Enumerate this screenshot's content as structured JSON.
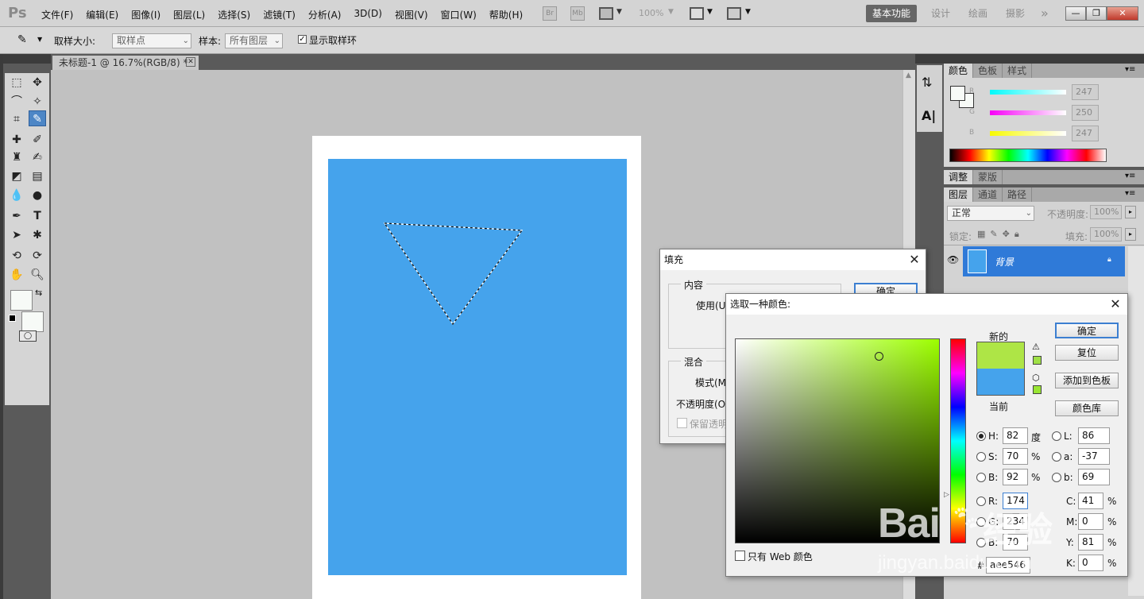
{
  "app": {
    "logo": "Ps"
  },
  "menus": [
    "文件(F)",
    "编辑(E)",
    "图像(I)",
    "图层(L)",
    "选择(S)",
    "滤镜(T)",
    "分析(A)",
    "3D(D)",
    "视图(V)",
    "窗口(W)",
    "帮助(H)"
  ],
  "appbar": {
    "br_label": "Br",
    "mb_label": "Mb",
    "zoom": "100%"
  },
  "workspaces": [
    "基本功能",
    "设计",
    "绘画",
    "摄影"
  ],
  "workspace_more": "»",
  "window_controls": {
    "minimize": "—",
    "restore": "❐",
    "close": "✕"
  },
  "options": {
    "sample_size_label": "取样大小:",
    "sample_size_value": "取样点",
    "sample_label": "样本:",
    "sample_value": "所有图层",
    "show_ring_label": "显示取样环",
    "show_ring_checked": true
  },
  "document": {
    "tab_title": "未标题-1 @ 16.7%(RGB/8) *",
    "close": "✕",
    "fill_color": "#45a3ec"
  },
  "color_panel": {
    "tabs": [
      "颜色",
      "色板",
      "样式"
    ],
    "r_label": "R",
    "r": "247",
    "g_label": "G",
    "g": "250",
    "b_label": "B",
    "b": "247"
  },
  "adjust_panel": {
    "tabs": [
      "调整",
      "蒙版"
    ]
  },
  "layers_panel": {
    "tabs": [
      "图层",
      "通道",
      "路径"
    ],
    "blend_mode": "正常",
    "opacity_label": "不透明度:",
    "opacity": "100%",
    "lock_label": "锁定:",
    "fill_label": "填充:",
    "fill": "100%",
    "layer_name": "背景",
    "layer_color": "#45a3ec"
  },
  "fill_dialog": {
    "title": "填充",
    "contents_group": "内容",
    "use_label": "使用(U",
    "ok": "确定",
    "blending_group": "混合",
    "mode_label": "模式(M",
    "opacity_label": "不透明度(O",
    "preserve_label": "保留透明"
  },
  "picker": {
    "title": "选取一种颜色:",
    "new_label": "新的",
    "current_label": "当前",
    "new_color": "#aee546",
    "current_color": "#45a3ec",
    "hue_color": "#9dff00",
    "ok": "确定",
    "reset": "复位",
    "add_swatch": "添加到色板",
    "color_libraries": "颜色库",
    "web_only_label": "只有 Web 颜色",
    "h_label": "H:",
    "h": "82",
    "h_unit": "度",
    "s_label": "S:",
    "s": "70",
    "s_unit": "%",
    "br_label": "B:",
    "br": "92",
    "br_unit": "%",
    "r_label": "R:",
    "r": "174",
    "g_label": "G:",
    "g": "234",
    "bb_label": "B:",
    "bb": "70",
    "l_label": "L:",
    "l": "86",
    "a_label": "a:",
    "a": "-37",
    "lab_b_label": "b:",
    "lab_b": "69",
    "c_label": "C:",
    "c": "41",
    "m_label": "M:",
    "m": "0",
    "y_label": "Y:",
    "y": "81",
    "k_label": "K:",
    "k": "0",
    "pct": "%",
    "hex_label": "#",
    "hex": "aee546"
  },
  "watermark": {
    "brand": "Bai",
    "brand2": "经验",
    "url": "jingyan.baidu.com"
  }
}
